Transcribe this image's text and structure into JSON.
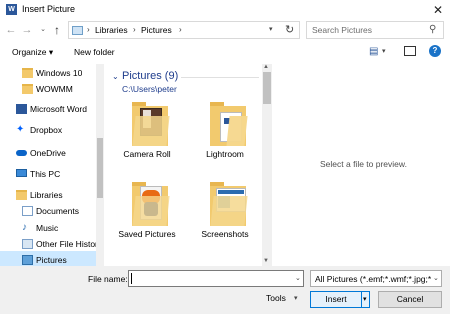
{
  "window": {
    "title": "Insert Picture",
    "close_glyph": "✕",
    "app_icon_letter": "W"
  },
  "nav": {
    "back_glyph": "←",
    "forward_glyph": "→",
    "recent_glyph": "⌄",
    "up_glyph": "↑",
    "breadcrumb": [
      "Libraries",
      "Pictures"
    ],
    "sep": "›",
    "refresh_glyph": "↻"
  },
  "search": {
    "placeholder": "Search Pictures",
    "icon": "search-icon"
  },
  "toolbar": {
    "organize": "Organize ▾",
    "new_folder": "New folder",
    "view_glyph": "▤",
    "help": "?"
  },
  "sidebar": {
    "items": [
      {
        "label": "Windows 10",
        "icon": "folder-icon"
      },
      {
        "label": "WOWMM",
        "icon": "folder-icon"
      },
      {
        "label": "Microsoft Word",
        "icon": "word-icon"
      },
      {
        "label": "Dropbox",
        "icon": "dropbox-icon"
      },
      {
        "label": "OneDrive",
        "icon": "onedrive-icon"
      },
      {
        "label": "This PC",
        "icon": "computer-icon"
      },
      {
        "label": "Libraries",
        "icon": "libraries-icon"
      },
      {
        "label": "Documents",
        "icon": "documents-icon"
      },
      {
        "label": "Music",
        "icon": "music-icon"
      },
      {
        "label": "Other File Histor",
        "icon": "library-icon"
      },
      {
        "label": "Pictures",
        "icon": "pictures-icon"
      }
    ]
  },
  "content": {
    "group_title": "Pictures (9)",
    "group_path": "C:\\Users\\peter",
    "tiles": [
      {
        "label": "Camera Roll"
      },
      {
        "label": "Lightroom"
      },
      {
        "label": "Saved Pictures"
      },
      {
        "label": "Screenshots"
      }
    ]
  },
  "preview": {
    "message": "Select a file to preview."
  },
  "footer": {
    "filename_label": "File name:",
    "filename_value": "",
    "filetype": "All Pictures (*.emf;*.wmf;*.jpg;*",
    "tools": "Tools",
    "insert": "Insert",
    "cancel": "Cancel"
  },
  "colors": {
    "accent": "#0078d7",
    "link": "#1e3c8c",
    "selection": "#cce8ff"
  }
}
